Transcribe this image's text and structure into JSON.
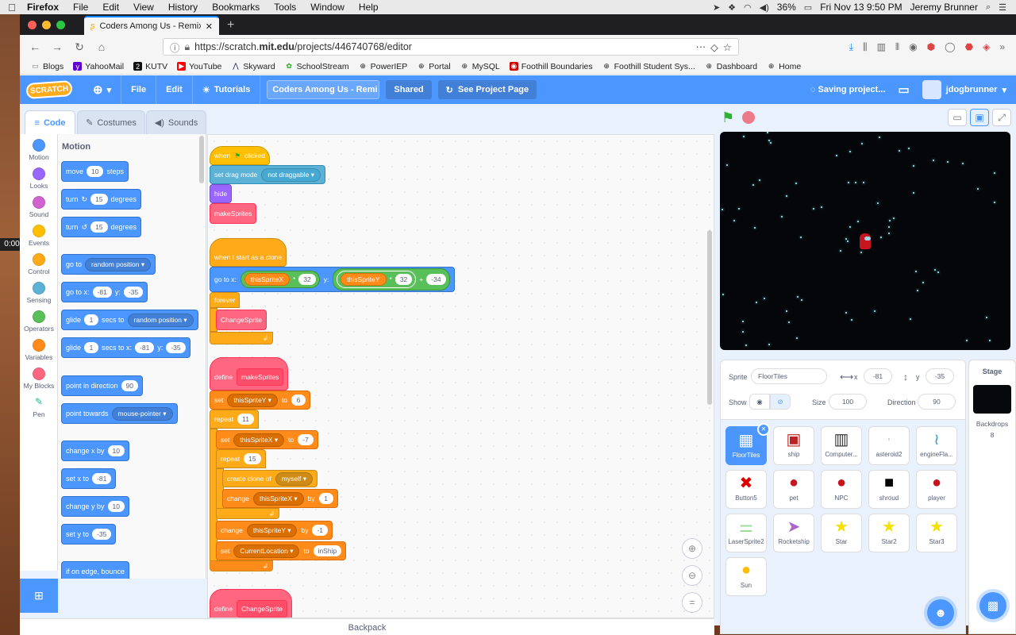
{
  "mac": {
    "app": "Firefox",
    "menus": [
      "File",
      "Edit",
      "View",
      "History",
      "Bookmarks",
      "Tools",
      "Window",
      "Help"
    ],
    "battery": "36%",
    "datetime": "Fri Nov 13  9:50 PM",
    "user": "Jeremy Brunner"
  },
  "browser": {
    "tab_title": "Coders Among Us - Remix This",
    "url_prefix": "https://scratch.",
    "url_domain": "mit.edu",
    "url_path": "/projects/446740768/editor",
    "bookmarks": [
      "Blogs",
      "YahooMail",
      "KUTV",
      "YouTube",
      "Skyward",
      "SchoolStream",
      "PowerIEP",
      "Portal",
      "MySQL",
      "Foothill Boundaries",
      "Foothill Student Sys...",
      "Dashboard",
      "Home"
    ]
  },
  "scratch": {
    "logo": "SCRATCH",
    "file": "File",
    "edit": "Edit",
    "tutorials": "Tutorials",
    "project_title": "Coders Among Us - Remi ...",
    "shared": "Shared",
    "see_project": "See Project Page",
    "saving": "Saving project...",
    "username": "jdogbrunner",
    "tabs": {
      "code": "Code",
      "costumes": "Costumes",
      "sounds": "Sounds"
    },
    "categories": [
      {
        "name": "Motion",
        "color": "#4c97ff"
      },
      {
        "name": "Looks",
        "color": "#9966ff"
      },
      {
        "name": "Sound",
        "color": "#cf63cf"
      },
      {
        "name": "Events",
        "color": "#ffbf00"
      },
      {
        "name": "Control",
        "color": "#ffab19"
      },
      {
        "name": "Sensing",
        "color": "#5cb1d6"
      },
      {
        "name": "Operators",
        "color": "#59c059"
      },
      {
        "name": "Variables",
        "color": "#ff8c1a"
      },
      {
        "name": "My Blocks",
        "color": "#ff6680"
      },
      {
        "name": "Pen",
        "color": "#0fbd8c"
      }
    ],
    "palette": {
      "title": "Motion",
      "move": [
        "move",
        "10",
        "steps"
      ],
      "turn_r": [
        "turn",
        "15",
        "degrees"
      ],
      "turn_l": [
        "turn",
        "15",
        "degrees"
      ],
      "goto": [
        "go to",
        "random position"
      ],
      "gotoxy": [
        "go to x:",
        "-81",
        "y:",
        "-35"
      ],
      "glide1": [
        "glide",
        "1",
        "secs to",
        "random position"
      ],
      "glide2": [
        "glide",
        "1",
        "secs to x:",
        "-81",
        "y:",
        "-35"
      ],
      "point_dir": [
        "point in direction",
        "90"
      ],
      "point_towards": [
        "point towards",
        "mouse-pointer"
      ],
      "change_x": [
        "change x by",
        "10"
      ],
      "set_x": [
        "set x to",
        "-81"
      ],
      "change_y": [
        "change y by",
        "10"
      ],
      "set_y": [
        "set y to",
        "-35"
      ],
      "bounce": "if on edge, bounce"
    },
    "script": {
      "when_flag": [
        "when",
        "clicked"
      ],
      "drag": [
        "set drag mode",
        "not draggable"
      ],
      "hide": "hide",
      "makeSprites": "makeSprites",
      "clone_hat": "when I start as a clone",
      "goto": [
        "go to x:",
        "thisSpriteX",
        "*",
        "32",
        "y:",
        "thisSpriteY",
        "*",
        "32",
        "+",
        "-34"
      ],
      "forever": "forever",
      "changeSprite": "ChangeSprite",
      "define1": [
        "define",
        "makeSprites"
      ],
      "set1": [
        "set",
        "thisSpriteY",
        "to",
        "6"
      ],
      "repeat1": [
        "repeat",
        "11"
      ],
      "set2": [
        "set",
        "thisSpriteX",
        "to",
        "-7"
      ],
      "repeat2": [
        "repeat",
        "15"
      ],
      "create_clone": [
        "create clone of",
        "myself"
      ],
      "change1": [
        "change",
        "thisSpriteX",
        "by",
        "1"
      ],
      "change2": [
        "change",
        "thisSpriteY",
        "by",
        "-1"
      ],
      "set3": [
        "set",
        "CurrentLocation",
        "to",
        "inShip"
      ],
      "define2": [
        "define",
        "ChangeSprite"
      ]
    },
    "backpack": "Backpack",
    "sprite_info": {
      "sprite_label": "Sprite",
      "sprite_name": "FloorTiles",
      "x_label": "x",
      "x": "-81",
      "y_label": "y",
      "y": "-35",
      "show_label": "Show",
      "size_label": "Size",
      "size": "100",
      "direction_label": "Direction",
      "direction": "90"
    },
    "sprites": [
      {
        "name": "FloorTiles",
        "icon": "▦"
      },
      {
        "name": "ship",
        "icon": "▣"
      },
      {
        "name": "Computer...",
        "icon": "▥"
      },
      {
        "name": "asteroid2",
        "icon": "·"
      },
      {
        "name": "engineFla...",
        "icon": "≀"
      },
      {
        "name": "Button5",
        "icon": "✖"
      },
      {
        "name": "pet",
        "icon": "●"
      },
      {
        "name": "NPC",
        "icon": "●"
      },
      {
        "name": "shroud",
        "icon": "■"
      },
      {
        "name": "player",
        "icon": "●"
      },
      {
        "name": "LaserSprite2",
        "icon": "⚌"
      },
      {
        "name": "Rocketship",
        "icon": "➤"
      },
      {
        "name": "Star",
        "icon": "★"
      },
      {
        "name": "Star2",
        "icon": "★"
      },
      {
        "name": "Star3",
        "icon": "★"
      },
      {
        "name": "Sun",
        "icon": "●"
      }
    ],
    "stage_panel": {
      "title": "Stage",
      "backdrops_label": "Backdrops",
      "backdrops": "8"
    }
  },
  "sidetimer": "0:00"
}
